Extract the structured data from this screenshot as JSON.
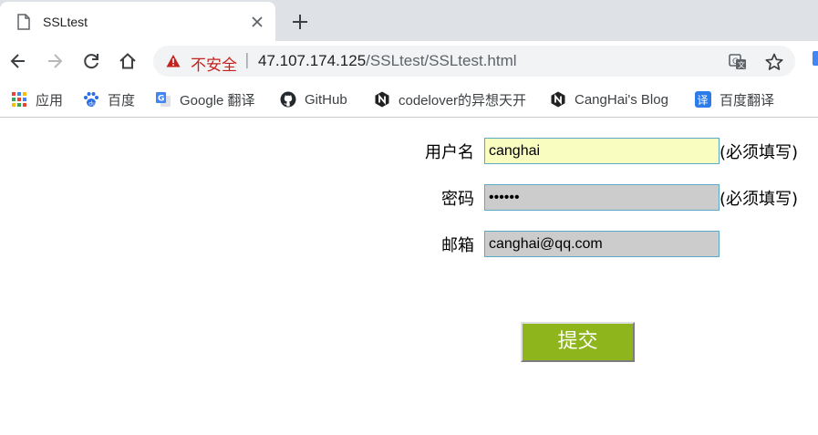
{
  "browser": {
    "tab_title": "SSLtest",
    "security_label": "不安全",
    "separator": "|",
    "url_host": "47.107.174.125",
    "url_path": "/SSLtest/SSLtest.html"
  },
  "bookmarks": [
    {
      "label": "应用",
      "icon": "apps-grid-icon"
    },
    {
      "label": "百度",
      "icon": "baidu-paw-icon"
    },
    {
      "label": "Google 翻译",
      "icon": "google-translate-icon"
    },
    {
      "label": "GitHub",
      "icon": "github-icon"
    },
    {
      "label": "codelover的异想天开",
      "icon": "n-logo-icon"
    },
    {
      "label": "CangHai's Blog",
      "icon": "n-logo-icon"
    },
    {
      "label": "百度翻译",
      "icon": "baidu-translate-icon"
    }
  ],
  "form": {
    "username_label": "用户名",
    "username_value": "canghai",
    "username_hint": "(必须填写)",
    "password_label": "密码",
    "password_value": "••••••",
    "password_hint": "(必须填写)",
    "email_label": "邮箱",
    "email_value": "canghai@qq.com",
    "submit_label": "提交"
  },
  "colors": {
    "insecure_text": "#c5221f",
    "username_bg": "#fafdc0",
    "field_bg": "#cccccc",
    "field_border": "#5aa9c9",
    "submit_bg": "#8fb51c"
  }
}
